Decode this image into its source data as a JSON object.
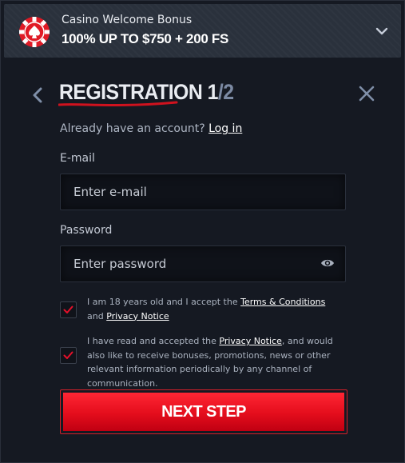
{
  "bonus": {
    "title": "Casino Welcome Bonus",
    "amount": "100% UP TO $750 + 200 FS"
  },
  "header": {
    "title_word": "REGISTRATION",
    "step_current": "1",
    "step_separator": "/",
    "step_total": "2"
  },
  "login": {
    "prompt": "Already have an account?",
    "link": "Log in"
  },
  "form": {
    "email_label": "E-mail",
    "email_placeholder": "Enter e-mail",
    "password_label": "Password",
    "password_placeholder": "Enter password"
  },
  "consents": [
    {
      "checked": true,
      "text_before": "I am 18 years old and I accept the ",
      "link1": "Terms & Conditions",
      "text_middle": " and ",
      "link2": "Privacy Notice",
      "text_after": ""
    },
    {
      "checked": true,
      "text_before": "I have read and accepted the ",
      "link1": "Privacy Notice",
      "text_after": ", and would also like to receive bonuses, promotions, news or other relevant information periodically by any channel of communication."
    }
  ],
  "next_button": "NEXT STEP",
  "colors": {
    "accent_red": "#e40d1c",
    "background": "#151922",
    "banner": "#2a313c",
    "step_total": "#7c8aa3"
  },
  "icons": [
    "poker-chip-icon",
    "chevron-down-icon",
    "chevron-left-icon",
    "close-icon",
    "eye-icon",
    "checkmark-icon"
  ]
}
